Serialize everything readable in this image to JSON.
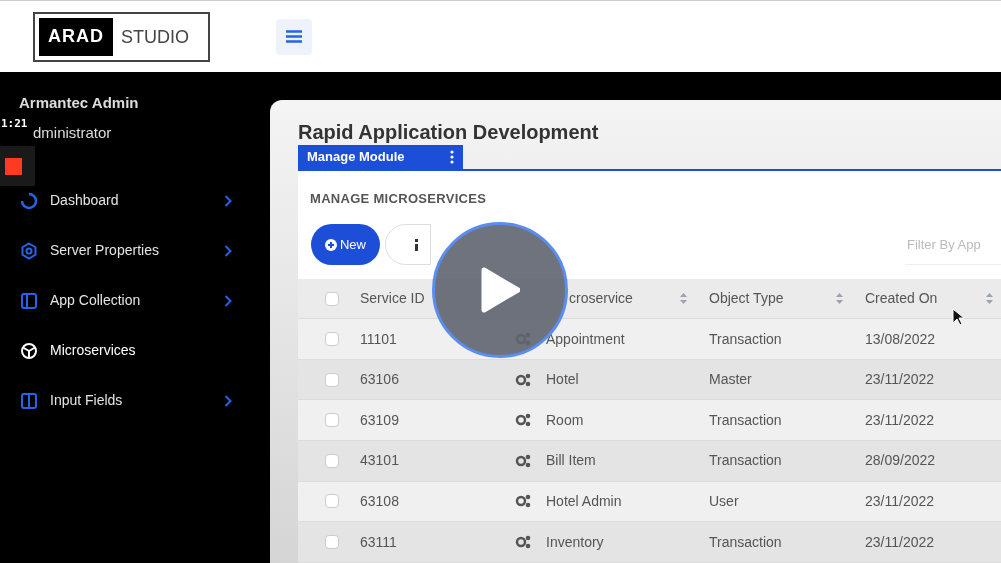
{
  "header": {
    "logo_dark": "ARAD",
    "logo_light": "STUDIO"
  },
  "sidebar": {
    "user_name": "Armantec Admin",
    "user_role": "dministrator",
    "items": [
      {
        "label": "Dashboard",
        "expandable": true,
        "selected": false
      },
      {
        "label": "Server Properties",
        "expandable": true,
        "selected": false
      },
      {
        "label": "App Collection",
        "expandable": true,
        "selected": false
      },
      {
        "label": "Microservices",
        "expandable": false,
        "selected": true
      },
      {
        "label": "Input Fields",
        "expandable": true,
        "selected": false
      }
    ]
  },
  "main": {
    "title": "Rapid Application Development",
    "tab": {
      "label": "Manage Module",
      "selected": true
    },
    "card_title": "MANAGE MICROSERVICES",
    "new_button": "New",
    "filter": {
      "placeholder": "Filter By App"
    },
    "table": {
      "header_checked": false,
      "columns": [
        "Service ID",
        "croservice",
        "Object Type",
        "Created On"
      ],
      "rows": [
        {
          "checked": false,
          "service_id": "11101",
          "microservice": "Appointment",
          "object_type": "Transaction",
          "created_on": "13/08/2022"
        },
        {
          "checked": false,
          "service_id": "63106",
          "microservice": "Hotel",
          "object_type": "Master",
          "created_on": "23/11/2022"
        },
        {
          "checked": false,
          "service_id": "63109",
          "microservice": "Room",
          "object_type": "Transaction",
          "created_on": "23/11/2022"
        },
        {
          "checked": false,
          "service_id": "43101",
          "microservice": "Bill Item",
          "object_type": "Transaction",
          "created_on": "28/09/2022"
        },
        {
          "checked": false,
          "service_id": "63108",
          "microservice": "Hotel Admin",
          "object_type": "User",
          "created_on": "23/11/2022"
        },
        {
          "checked": false,
          "service_id": "63111",
          "microservice": "Inventory",
          "object_type": "Transaction",
          "created_on": "23/11/2022"
        }
      ]
    }
  },
  "video_overlay": {
    "timestamp": "1:21"
  }
}
